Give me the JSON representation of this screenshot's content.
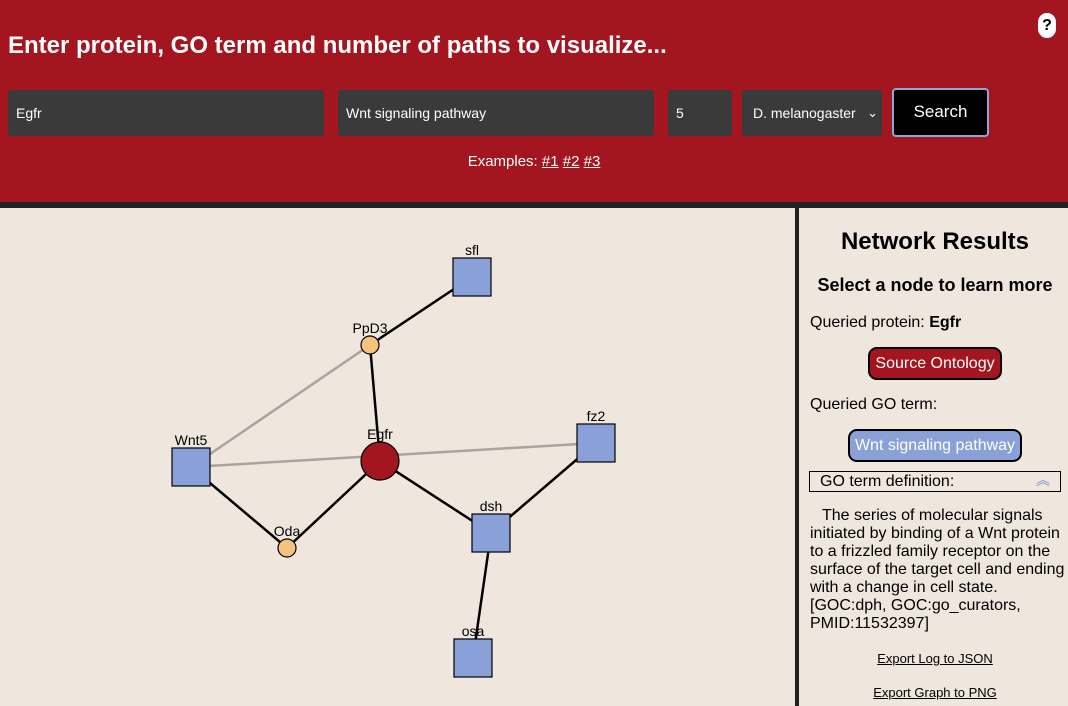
{
  "header": {
    "title": "Enter protein, GO term and number of paths to visualize...",
    "help_label": "?",
    "protein_value": "Egfr",
    "go_term_value": "Wnt signaling pathway",
    "paths_value": "5",
    "species_value": "D. melanogaster",
    "search_label": "Search",
    "examples_label": "Examples:",
    "examples": [
      "#1",
      "#2",
      "#3"
    ]
  },
  "graph": {
    "colors": {
      "source": "#a3161f",
      "go_protein": "#8aa0d8",
      "intermediate": "#f5c27f",
      "edge": "#000000",
      "shared_edge": "#aaa49f"
    },
    "nodes": [
      {
        "id": "sfl",
        "label": "sfl",
        "kind": "go_protein"
      },
      {
        "id": "PpD3",
        "label": "PpD3",
        "kind": "intermediate"
      },
      {
        "id": "Wnt5",
        "label": "Wnt5",
        "kind": "go_protein"
      },
      {
        "id": "Egfr",
        "label": "Egfr",
        "kind": "source"
      },
      {
        "id": "fz2",
        "label": "fz2",
        "kind": "go_protein"
      },
      {
        "id": "dsh",
        "label": "dsh",
        "kind": "go_protein"
      },
      {
        "id": "Oda",
        "label": "Oda",
        "kind": "intermediate"
      },
      {
        "id": "osa",
        "label": "osa",
        "kind": "go_protein"
      }
    ],
    "edges": [
      {
        "from": "PpD3",
        "to": "sfl",
        "type": "path"
      },
      {
        "from": "Egfr",
        "to": "PpD3",
        "type": "path"
      },
      {
        "from": "Wnt5",
        "to": "PpD3",
        "type": "shared"
      },
      {
        "from": "Wnt5",
        "to": "fz2",
        "type": "shared"
      },
      {
        "from": "Wnt5",
        "to": "Oda",
        "type": "path"
      },
      {
        "from": "Oda",
        "to": "Egfr",
        "type": "path"
      },
      {
        "from": "Egfr",
        "to": "dsh",
        "type": "path"
      },
      {
        "from": "dsh",
        "to": "fz2",
        "type": "path"
      },
      {
        "from": "dsh",
        "to": "osa",
        "type": "path"
      }
    ]
  },
  "panel": {
    "title": "Network Results",
    "subtitle": "Select a node to learn more",
    "queried_protein_label": "Queried protein:",
    "queried_protein": "Egfr",
    "source_button": "Source Ontology",
    "queried_go_label": "Queried GO term:",
    "go_button": "Wnt signaling pathway",
    "definition_label": "GO term definition:",
    "definition_text": "The series of molecular signals initiated by binding of a Wnt protein to a frizzled family receptor on the surface of the target cell and ending with a change in cell state. [GOC:dph, GOC:go_curators, PMID:11532397]",
    "export_json": "Export Log to JSON",
    "export_png": "Export Graph to PNG"
  }
}
